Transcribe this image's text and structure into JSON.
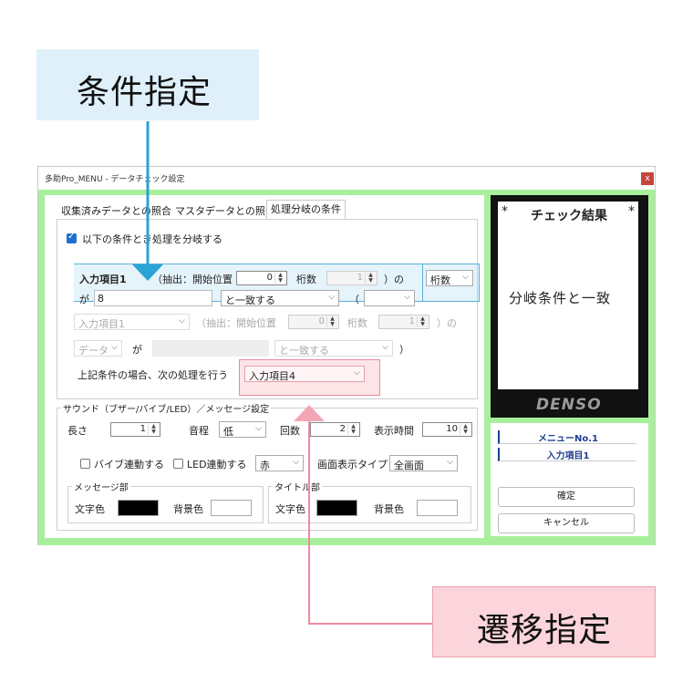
{
  "callouts": {
    "condition": "条件指定",
    "transition": "遷移指定"
  },
  "window": {
    "title": "多助Pro_MENU - データチェック設定",
    "close_label": "x"
  },
  "tabs": [
    {
      "label": "収集済みデータとの照合"
    },
    {
      "label": "マスタデータとの照合"
    },
    {
      "label": "処理分岐の条件",
      "active": true
    }
  ],
  "branch": {
    "enable_checkbox_label": "以下の条件とき処理を分岐する",
    "enable_checked": true,
    "row1": {
      "item_label": "入力項目1",
      "extract_label": "（抽出：開始位置",
      "start_value": "0",
      "digits_label": "桁数",
      "digits_value": "1",
      "no_label": "）の",
      "type_value": "桁数"
    },
    "row2": {
      "ga_label": "が",
      "value": "8",
      "match_value": "と一致する",
      "paren_label": "（",
      "paren_value": ""
    },
    "row3": {
      "item_value": "入力項目1",
      "extract_label": "（抽出：開始位置",
      "start_value": "0",
      "digits_label": "桁数",
      "digits_value": "1",
      "no_label": "）の"
    },
    "row4": {
      "type_value": "データ",
      "ga_label": "が",
      "match_value": "と一致する",
      "close_label": "）"
    },
    "next": {
      "label": "上記条件の場合、次の処理を行う",
      "value": "入力項目4"
    }
  },
  "sound": {
    "group_label": "サウンド（ブザー/バイブ/LED）／メッセージ設定",
    "length_label": "長さ",
    "length_value": "1",
    "pitch_label": "音程",
    "pitch_value": "低",
    "count_label": "回数",
    "count_value": "2",
    "duration_label": "表示時間",
    "duration_value": "10",
    "vibe_label": "バイブ連動する",
    "led_label": "LED連動する",
    "led_color_value": "赤",
    "display_type_label": "画面表示タイプ",
    "display_type_value": "全画面",
    "message_group_label": "メッセージ部",
    "title_group_label": "タイトル部",
    "text_color_label": "文字色",
    "bg_color_label": "背景色",
    "text_color_label_2": "文字色",
    "bg_color_label_2": "背景色"
  },
  "colors": {
    "message_text": "#000000",
    "message_bg": "#ffffff",
    "title_text": "#000000",
    "title_bg": "#ffffff",
    "accent_green": "#a8ef9c",
    "highlight_blue": "#5db0dd",
    "highlight_pink": "#ef8a9c"
  },
  "result": {
    "star_left": "*",
    "title": "チェック結果",
    "star_right": "*",
    "message": "分岐条件と一致",
    "brand": "DENSO"
  },
  "info": {
    "menu_no": "メニューNo.1",
    "item": "入力項目1"
  },
  "buttons": {
    "ok": "確定",
    "cancel": "キャンセル"
  }
}
